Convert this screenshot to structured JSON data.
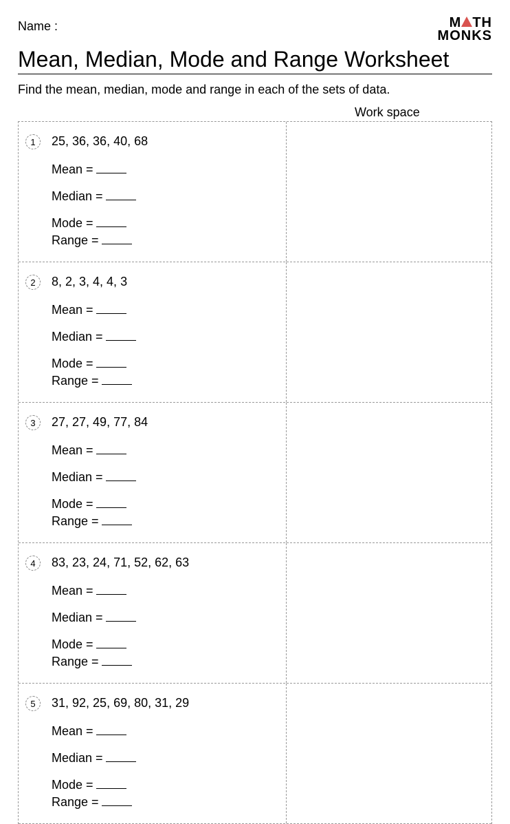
{
  "header": {
    "name_label": "Name :",
    "logo_top": "M",
    "logo_top2": "TH",
    "logo_bottom": "MONKS"
  },
  "title": "Mean, Median, Mode and Range Worksheet",
  "instructions": "Find the mean, median, mode and range in each of the sets of data.",
  "workspace_label": "Work space",
  "labels": {
    "mean": "Mean =",
    "median": "Median =",
    "mode": "Mode =",
    "range": "Range ="
  },
  "problems": [
    {
      "num": "1",
      "data": "25, 36, 36, 40, 68"
    },
    {
      "num": "2",
      "data": "8, 2, 3, 4, 4, 3"
    },
    {
      "num": "3",
      "data": "27, 27, 49, 77, 84"
    },
    {
      "num": "4",
      "data": "83, 23, 24, 71, 52, 62, 63"
    },
    {
      "num": "5",
      "data": "31, 92, 25, 69, 80, 31, 29"
    }
  ]
}
